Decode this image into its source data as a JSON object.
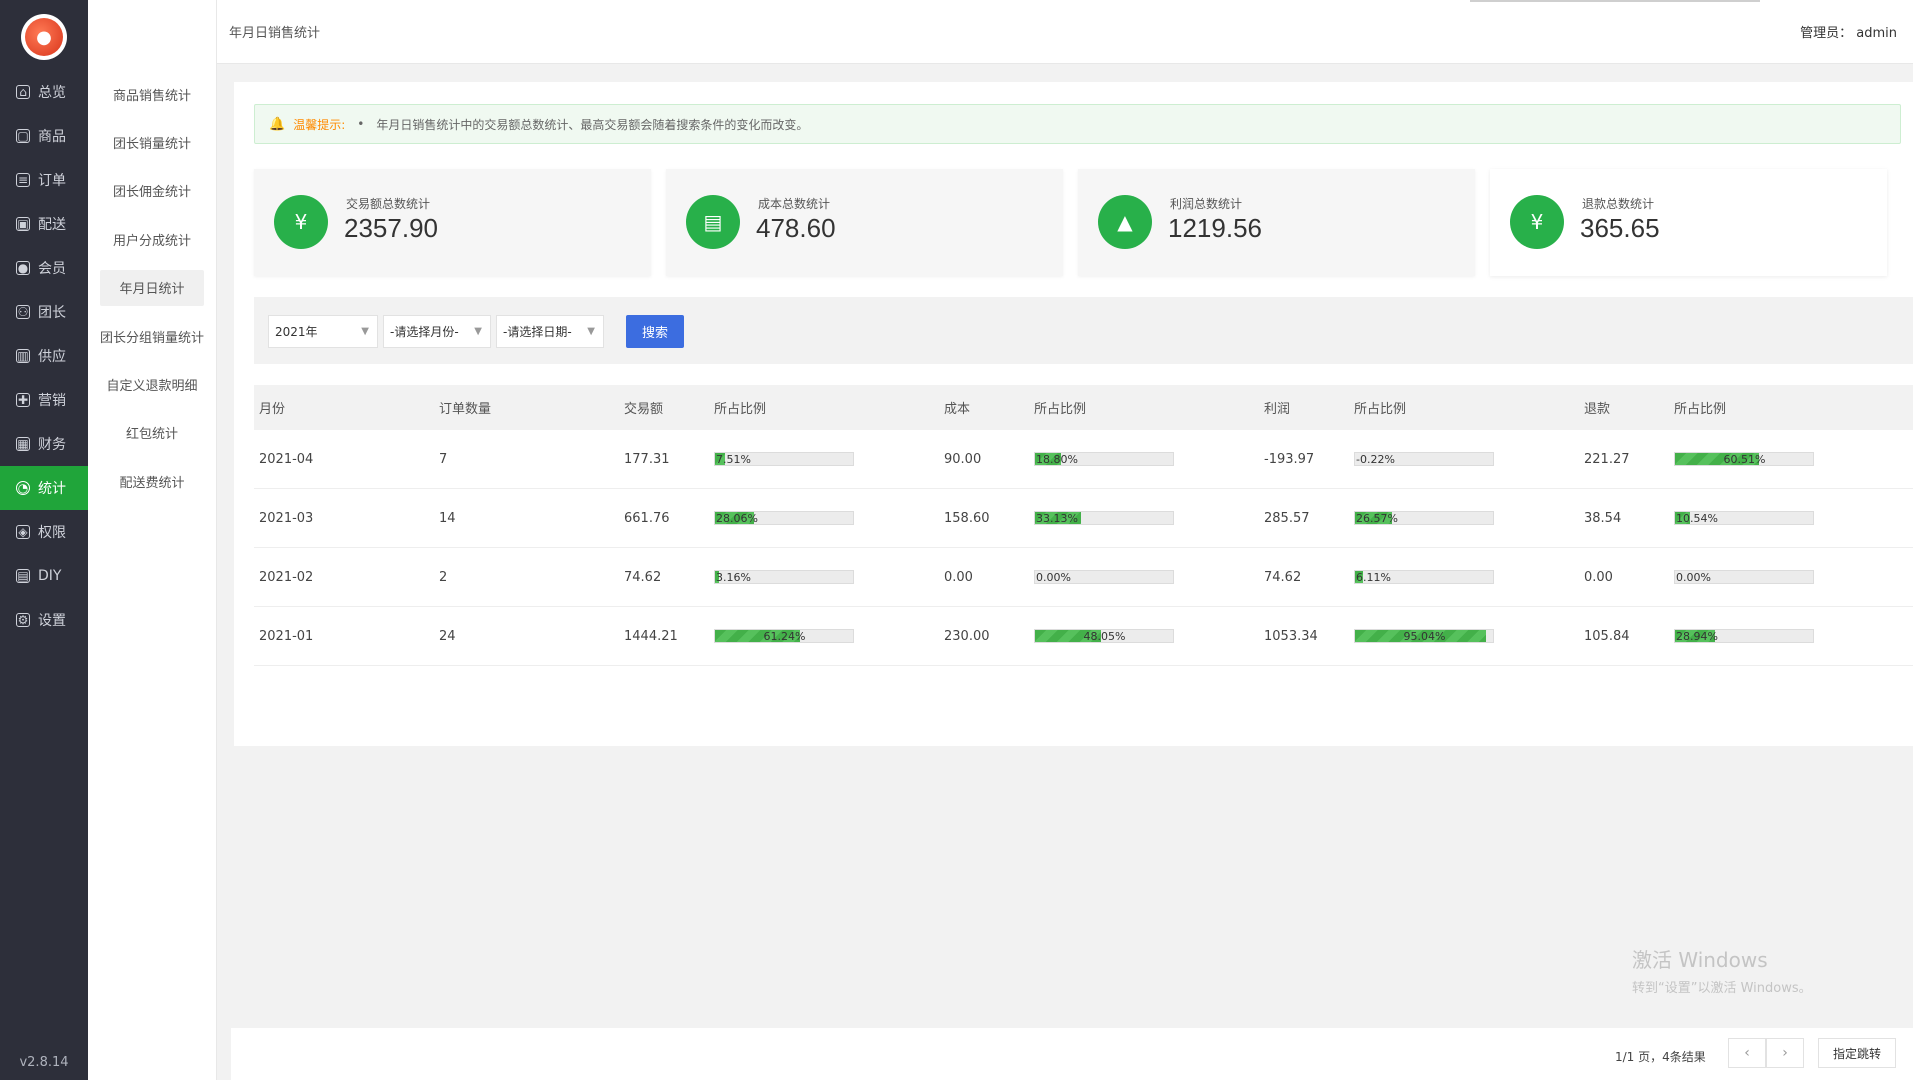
{
  "nav": {
    "items": [
      {
        "label": "总览",
        "icon": "home-icon"
      },
      {
        "label": "商品",
        "icon": "box-icon"
      },
      {
        "label": "订单",
        "icon": "order-icon"
      },
      {
        "label": "配送",
        "icon": "delivery-icon"
      },
      {
        "label": "会员",
        "icon": "user-icon"
      },
      {
        "label": "团长",
        "icon": "group-icon"
      },
      {
        "label": "供应",
        "icon": "supply-icon"
      },
      {
        "label": "营销",
        "icon": "gift-icon"
      },
      {
        "label": "财务",
        "icon": "finance-icon"
      },
      {
        "label": "统计",
        "icon": "pie-icon",
        "active": true
      },
      {
        "label": "权限",
        "icon": "shield-icon"
      },
      {
        "label": "DIY",
        "icon": "layout-icon"
      },
      {
        "label": "设置",
        "icon": "gear-icon"
      }
    ],
    "version": "v2.8.14"
  },
  "subnav": {
    "items": [
      "商品销售统计",
      "团长销量统计",
      "团长佣金统计",
      "用户分成统计",
      "年月日统计",
      "团长分组销量统计",
      "自定义退款明细",
      "红包统计",
      "配送费统计"
    ],
    "active_index": 4
  },
  "header": {
    "breadcrumb": "年月日销售统计",
    "admin": "管理员： admin"
  },
  "tip": {
    "label": "温馨提示:",
    "text": "年月日销售统计中的交易额总数统计、最高交易额会随着搜索条件的变化而改变。"
  },
  "stats": [
    {
      "title": "交易额总数统计",
      "value": "2357.90",
      "icon": "yuan-shield-icon"
    },
    {
      "title": "成本总数统计",
      "value": "478.60",
      "icon": "archive-icon"
    },
    {
      "title": "利润总数统计",
      "value": "1219.56",
      "icon": "growth-chart-icon"
    },
    {
      "title": "退款总数统计",
      "value": "365.65",
      "icon": "refund-icon"
    }
  ],
  "filter": {
    "year": "2021年",
    "month_placeholder": "-请选择月份-",
    "day_placeholder": "-请选择日期-",
    "search_label": "搜索"
  },
  "table": {
    "headers": [
      "月份",
      "订单数量",
      "交易额",
      "所占比例",
      "成本",
      "所占比例",
      "利润",
      "所占比例",
      "退款",
      "所占比例"
    ],
    "rows": [
      {
        "month": "2021-04",
        "orders": "7",
        "amount": "177.31",
        "amount_pct": "7.51%",
        "amount_frac": 0.0751,
        "cost": "90.00",
        "cost_pct": "18.80%",
        "cost_frac": 0.188,
        "profit": "-193.97",
        "profit_pct": "-0.22%",
        "profit_frac": 0,
        "refund": "221.27",
        "refund_pct": "60.51%",
        "refund_frac": 0.6051
      },
      {
        "month": "2021-03",
        "orders": "14",
        "amount": "661.76",
        "amount_pct": "28.06%",
        "amount_frac": 0.2806,
        "cost": "158.60",
        "cost_pct": "33.13%",
        "cost_frac": 0.3313,
        "profit": "285.57",
        "profit_pct": "26.57%",
        "profit_frac": 0.2657,
        "refund": "38.54",
        "refund_pct": "10.54%",
        "refund_frac": 0.1054
      },
      {
        "month": "2021-02",
        "orders": "2",
        "amount": "74.62",
        "amount_pct": "3.16%",
        "amount_frac": 0.0316,
        "cost": "0.00",
        "cost_pct": "0.00%",
        "cost_frac": 0,
        "profit": "74.62",
        "profit_pct": "6.11%",
        "profit_frac": 0.0611,
        "refund": "0.00",
        "refund_pct": "0.00%",
        "refund_frac": 0
      },
      {
        "month": "2021-01",
        "orders": "24",
        "amount": "1444.21",
        "amount_pct": "61.24%",
        "amount_frac": 0.6124,
        "cost": "230.00",
        "cost_pct": "48.05%",
        "cost_frac": 0.4805,
        "profit": "1053.34",
        "profit_pct": "95.04%",
        "profit_frac": 0.9504,
        "refund": "105.84",
        "refund_pct": "28.94%",
        "refund_frac": 0.2894
      }
    ]
  },
  "pager": {
    "info": "1/1 页，4条结果",
    "prev": "‹",
    "next": "›",
    "jump_label": "指定跳转"
  },
  "watermark": {
    "line1": "激活 Windows",
    "line2": "转到“设置”以激活 Windows。"
  }
}
